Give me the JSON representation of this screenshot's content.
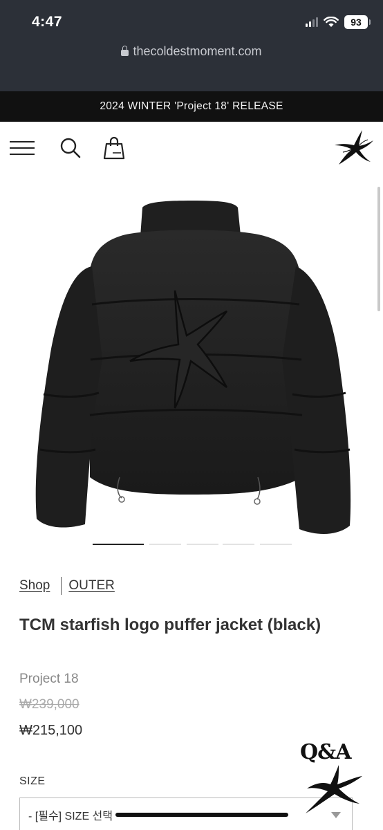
{
  "status_bar": {
    "time": "4:47",
    "battery": "93"
  },
  "browser": {
    "url": "thecoldestmoment.com"
  },
  "announcement": "2024 WINTER 'Project 18' RELEASE",
  "header": {
    "icons": [
      "menu-icon",
      "search-icon",
      "shopping-bag-icon",
      "starfish-logo"
    ]
  },
  "gallery": {
    "slide_count": 5,
    "active_slide": 1
  },
  "breadcrumb": {
    "shop": "Shop",
    "category": "OUTER"
  },
  "product": {
    "title": "TCM starfish logo puffer jacket (black)",
    "brand": "Project 18",
    "original_price": "₩239,000",
    "price": "₩215,100"
  },
  "options": {
    "size_label": "SIZE",
    "size_placeholder": "- [필수] SIZE 선택"
  },
  "qa_button": {
    "label": "Q&A"
  }
}
